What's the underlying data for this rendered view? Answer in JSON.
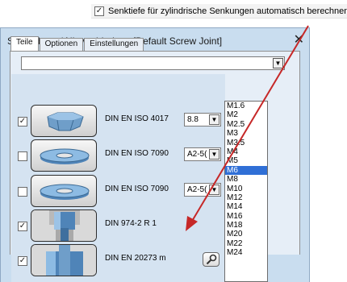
{
  "top_option": {
    "checked_mark": "✓",
    "label": "Senktiefe für zylindrische Senkungen automatisch berechnen"
  },
  "dialog": {
    "title": "Schrauben- / Nietverbindung [Default Screw Joint]",
    "close_glyph": "✕"
  },
  "tabs": [
    {
      "label": "Teile"
    },
    {
      "label": "Optionen"
    },
    {
      "label": "Einstellungen"
    }
  ],
  "combo": {
    "value": "",
    "arrow": "▼"
  },
  "parts": [
    {
      "checked": "✓",
      "name": "DIN EN ISO 4017",
      "option": "8.8",
      "arrow": "▼"
    },
    {
      "checked": "",
      "name": "DIN EN ISO 7090",
      "option": "A2-5(",
      "arrow": "▼"
    },
    {
      "checked": "",
      "name": "DIN EN ISO 7090",
      "option": "A2-5(",
      "arrow": "▼"
    },
    {
      "checked": "✓",
      "name": "DIN 974-2 R 1"
    },
    {
      "checked": "✓",
      "name": "DIN EN 20273 m"
    }
  ],
  "sizes": [
    "M1.6",
    "M2",
    "M2.5",
    "M3",
    "M3.5",
    "M4",
    "M5",
    "M6",
    "M8",
    "M10",
    "M12",
    "M14",
    "M16",
    "M18",
    "M20",
    "M22",
    "M24"
  ],
  "selected_size": "M6",
  "colors": {
    "arrow": "#c62828",
    "selection": "#2f6fd6",
    "dialog_bg": "#c9ddef"
  }
}
